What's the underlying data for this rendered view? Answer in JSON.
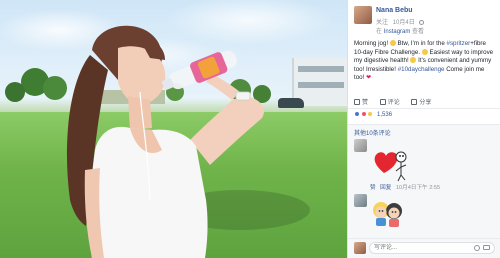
{
  "profile": {
    "name": "Nana Bebu",
    "follow": "关注",
    "date": "10月4日",
    "via_prefix": "在",
    "via_link": "Instagram",
    "via_suffix": "查看"
  },
  "post": {
    "greeting": "Morning jog!",
    "t1": " Btw, I'm in for the ",
    "tag1": "#spritzer",
    "t2": "+fibre 10-day Fibre Challenge.",
    "t3": " Easiest way to improve my digestive health!",
    "t4": " It's convenient and yummy too! Irresistible!",
    "tag2": "#10daychallenge",
    "t5": " Come join me too!"
  },
  "actions": {
    "like": "赞",
    "comment": "评论",
    "share": "分享"
  },
  "reactions": {
    "count": "1,536"
  },
  "comments": {
    "more": "其他10条评论",
    "reply": "回复",
    "time": "10月4日下午 2:55",
    "like": "赞"
  },
  "composer": {
    "placeholder": "写评论..."
  }
}
